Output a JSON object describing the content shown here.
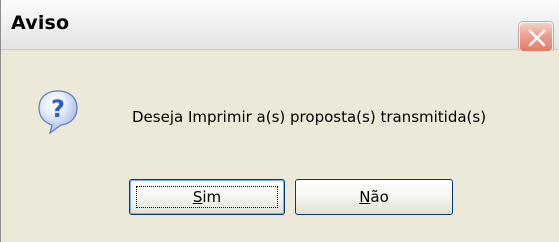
{
  "window": {
    "title": "Aviso"
  },
  "dialog": {
    "icon": "question-icon",
    "message": "Deseja Imprimir a(s) proposta(s) transmitida(s)"
  },
  "buttons": {
    "yes": {
      "mnemonic": "S",
      "rest": "im"
    },
    "no": {
      "mnemonic": "N",
      "rest": "ão"
    }
  },
  "colors": {
    "dialog_bg": "#ece9d8",
    "close_button": "#e07d69",
    "icon_blue": "#2a5fc9"
  }
}
